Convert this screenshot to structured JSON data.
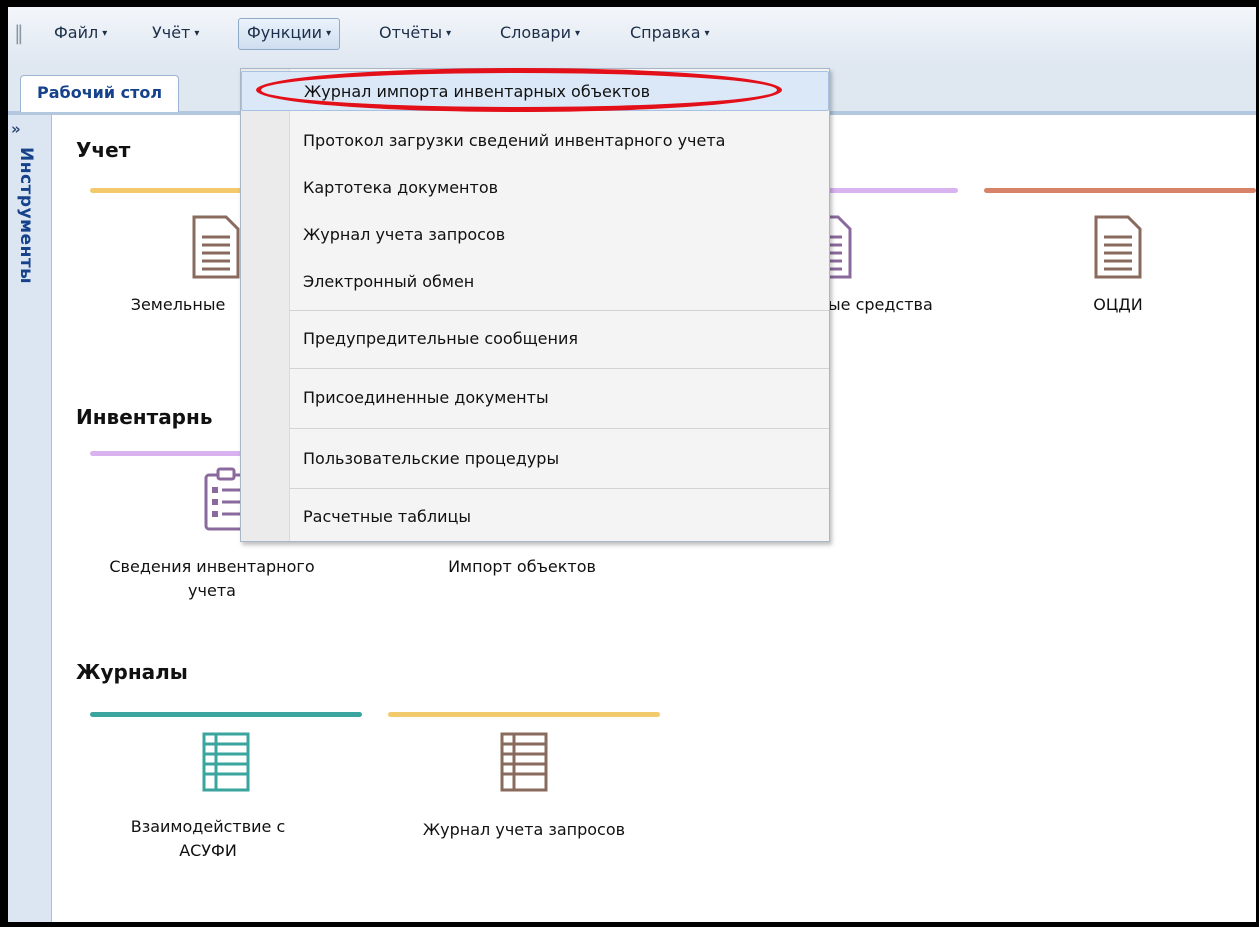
{
  "menubar": {
    "items": [
      {
        "label": "Файл"
      },
      {
        "label": "Учёт"
      },
      {
        "label": "Функции"
      },
      {
        "label": "Отчёты"
      },
      {
        "label": "Словари"
      },
      {
        "label": "Справка"
      }
    ],
    "caret": "▾"
  },
  "tabs": [
    {
      "label": "Рабочий стол"
    }
  ],
  "side_panel": {
    "expand_icon": "»",
    "label": "Инструменты"
  },
  "sections": [
    {
      "title": "Учет",
      "cards": [
        {
          "label": "Земельные",
          "color": "#f2c96b",
          "icon": "document-icon"
        },
        {
          "label": "ые средства",
          "color": "#d9b3f0",
          "icon": "document-icon"
        },
        {
          "label": "ОЦДИ",
          "color": "#d9826a",
          "icon": "document-icon"
        }
      ]
    },
    {
      "title": "Инвентарнь",
      "cards": [
        {
          "label": "Сведения инвентарного\nучета",
          "color": "#d9b3f0",
          "icon": "checklist-icon"
        },
        {
          "label": "Импорт объектов",
          "color": "#d9b3f0",
          "icon": "import-icon"
        }
      ]
    },
    {
      "title": "Журналы",
      "cards": [
        {
          "label": "Взаимодействие с\nАСУФИ",
          "color": "#3aa59e",
          "icon": "table-icon"
        },
        {
          "label": "Журнал учета запросов",
          "color": "#f2c96b",
          "icon": "table-icon"
        }
      ]
    }
  ],
  "dropdown": {
    "items": [
      {
        "label": "Журнал импорта инвентарных объектов",
        "highlighted": true
      },
      {
        "label": "Протокол загрузки сведений инвентарного учета"
      },
      {
        "label": "Картотека документов"
      },
      {
        "label": "Журнал учета запросов"
      },
      {
        "label": "Электронный обмен"
      },
      {
        "label": "Предупредительные сообщения"
      },
      {
        "label": "Присоединенные документы"
      },
      {
        "label": "Пользовательские процедуры"
      },
      {
        "label": "Расчетные таблицы"
      }
    ]
  },
  "colors": {
    "annotation": "#e3101a",
    "accent": "#15428b"
  }
}
